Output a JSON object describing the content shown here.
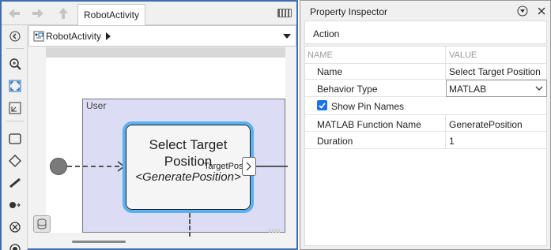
{
  "editor": {
    "tab_label": "RobotActivity",
    "breadcrumb": "RobotActivity",
    "lane_label": "User",
    "action": {
      "title": "Select Target Position",
      "function": "<GeneratePosition>",
      "pin_label": "TargetPos"
    },
    "icons": {
      "back": "back-arrow-icon",
      "forward": "forward-arrow-icon",
      "up": "up-arrow-icon",
      "keyboard": "keyboard-icon"
    }
  },
  "inspector": {
    "title": "Property Inspector",
    "section": "Action",
    "col_name": "NAME",
    "col_value": "VALUE",
    "rows": [
      {
        "name": "Name",
        "value": "Select Target Position"
      },
      {
        "name": "Behavior Type",
        "value": "MATLAB"
      },
      {
        "name": "Show Pin Names",
        "checked": true
      },
      {
        "name": "MATLAB Function Name",
        "value": "GeneratePosition"
      },
      {
        "name": "Duration",
        "value": "1"
      }
    ]
  },
  "colors": {
    "accent": "#3d6fb0",
    "selection": "#5ab0f0",
    "lane": "#dcdcf5",
    "checkbox": "#1a73e8"
  }
}
